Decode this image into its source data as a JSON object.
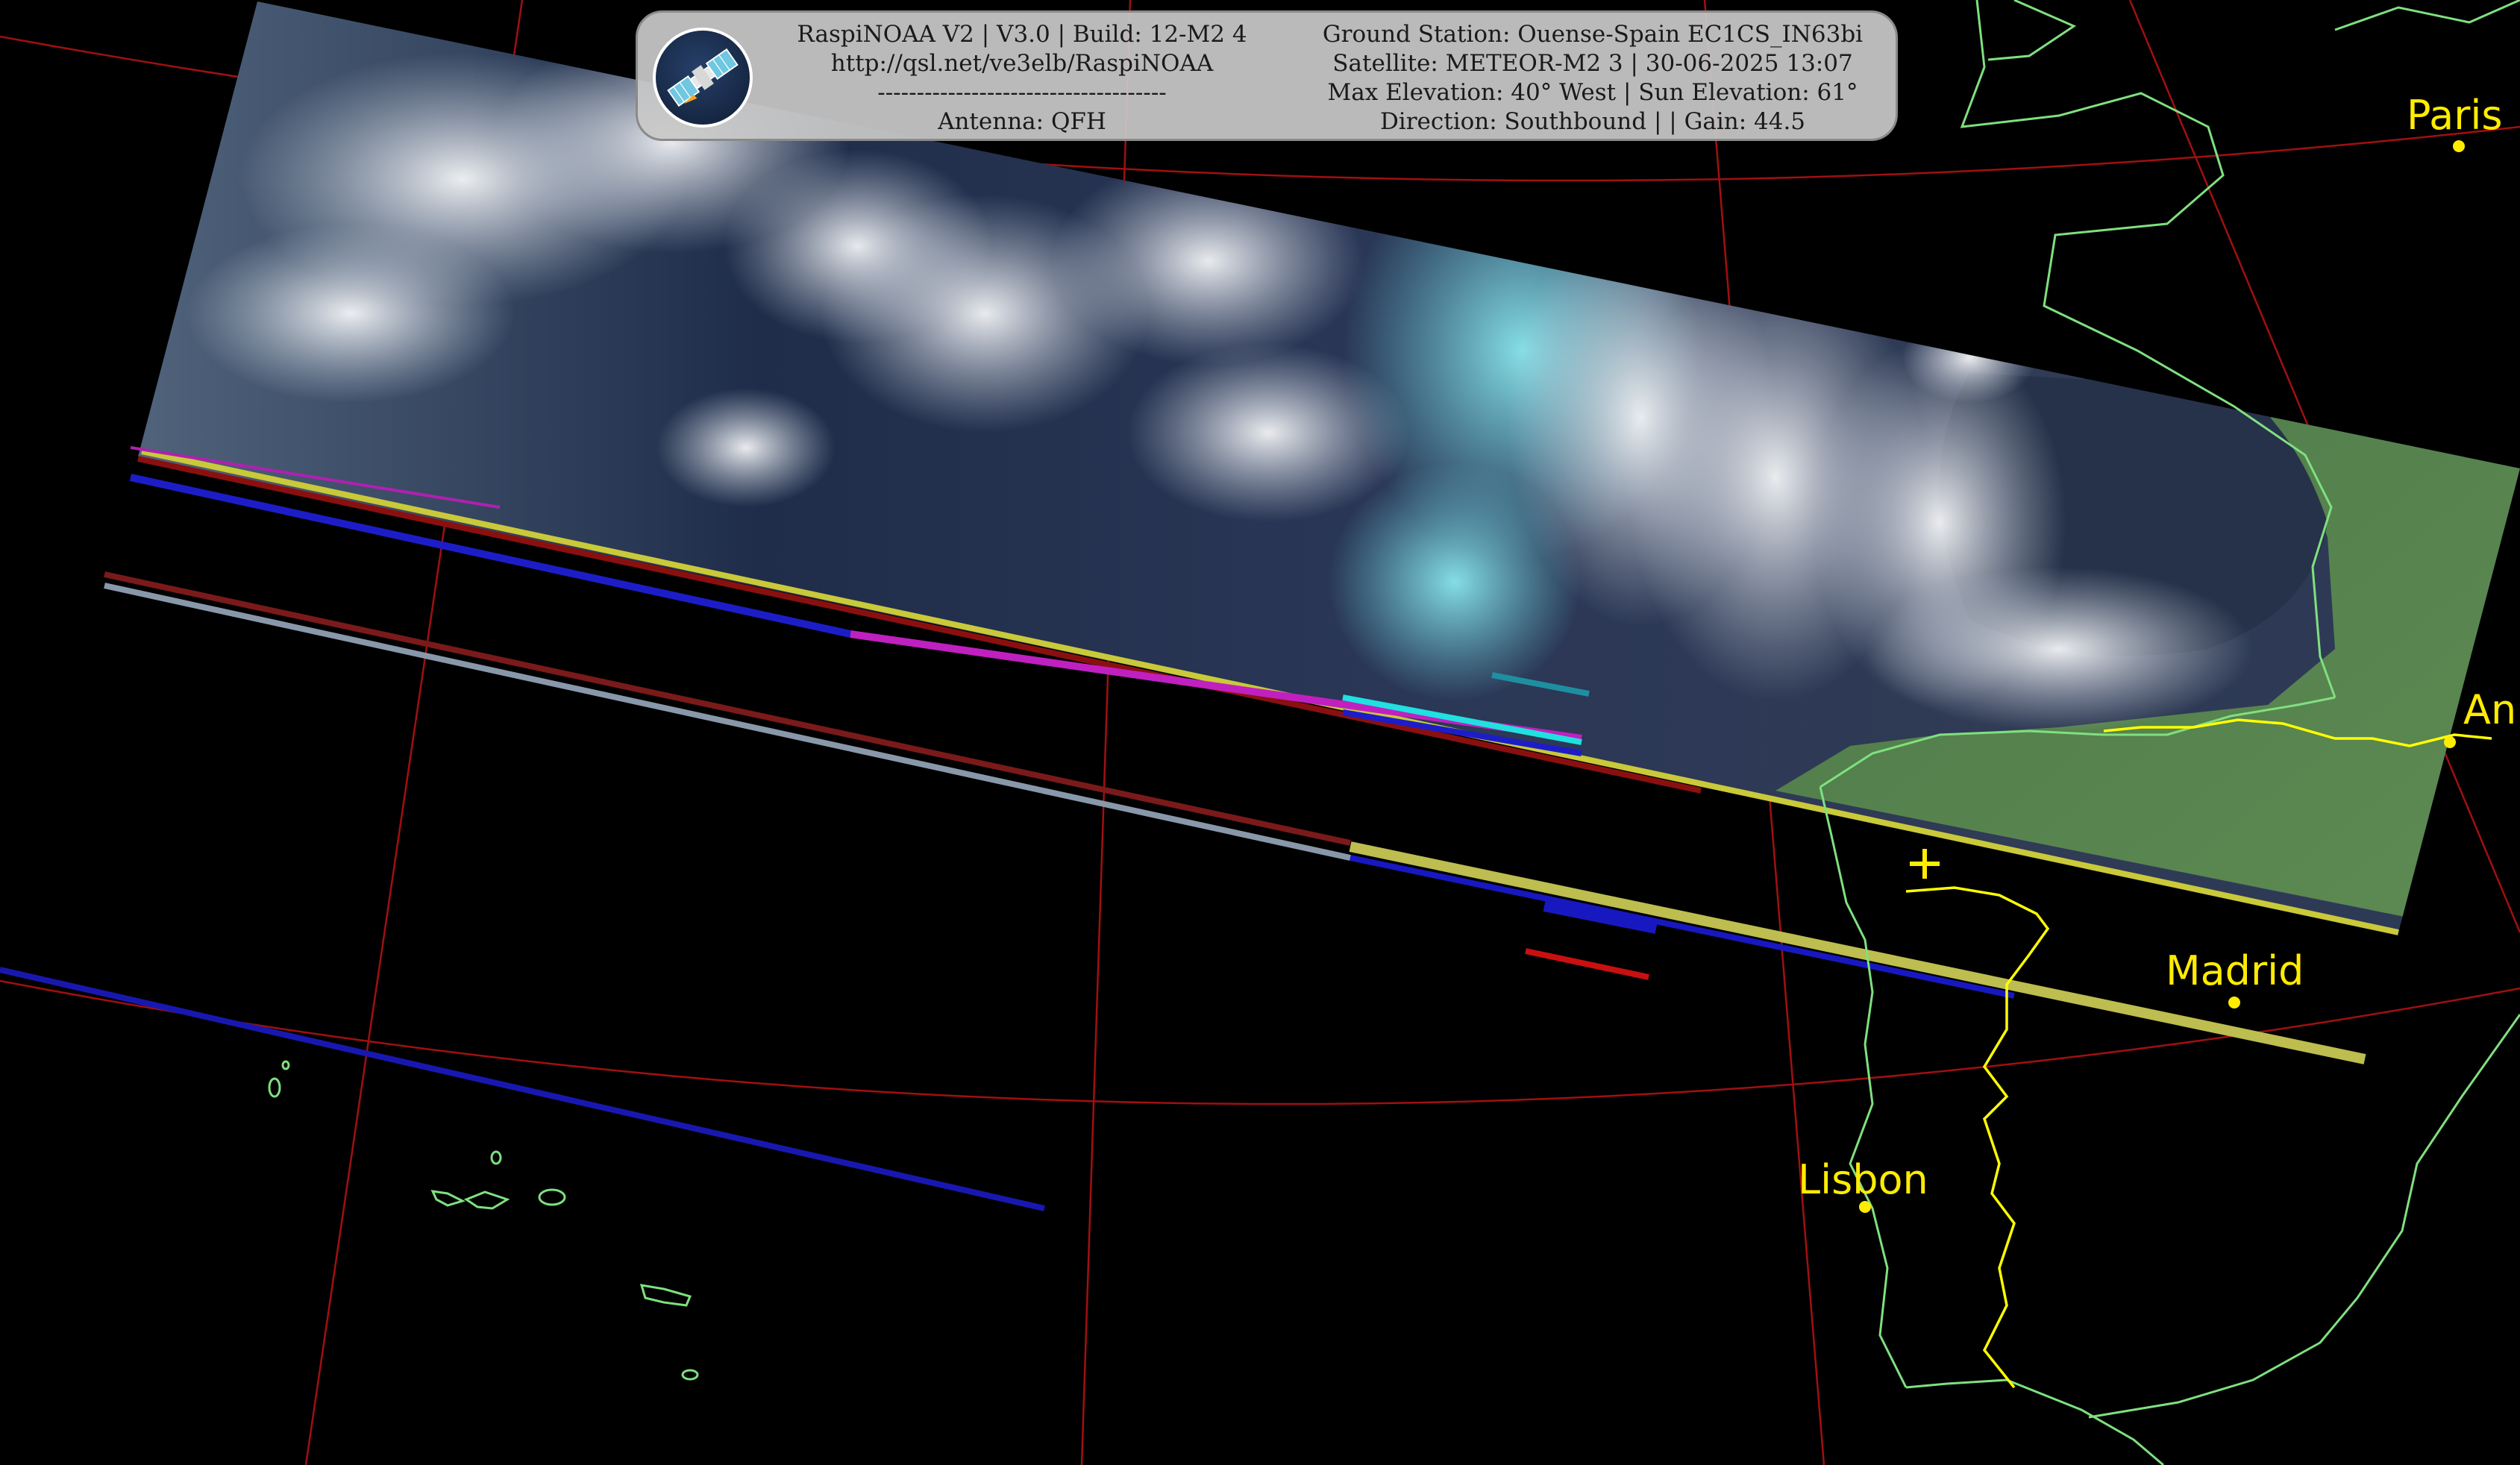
{
  "header": {
    "logo_icon": "satellite-icon",
    "left_lines": [
      "RaspiNOAA V2 | V3.0 | Build: 12-M2 4",
      "http://qsl.net/ve3elb/RaspiNOAA",
      "-------------------------------------",
      "Antenna: QFH"
    ],
    "right_lines": [
      "Ground Station: Ouense-Spain EC1CS_IN63bi",
      "Satellite: METEOR-M2 3 | 30-06-2025 13:07",
      "Max Elevation: 40° West | Sun Elevation: 61°",
      "Direction: Southbound | | Gain: 44.5"
    ]
  },
  "map": {
    "cities": [
      {
        "name": "Paris",
        "lon": 2.35,
        "lat": 48.86
      },
      {
        "name": "Madrid",
        "lon": -3.7,
        "lat": 40.42
      },
      {
        "name": "Lisbon",
        "lon": -9.14,
        "lat": 38.72
      },
      {
        "name": "An",
        "lon": 1.52,
        "lat": 42.51
      }
    ],
    "ground_station_marker": "plus-icon",
    "colors": {
      "coastline": "#7fe07f",
      "border": "#ffff00",
      "graticule": "#a01010",
      "city": "#ffec00",
      "background": "#000000"
    }
  }
}
